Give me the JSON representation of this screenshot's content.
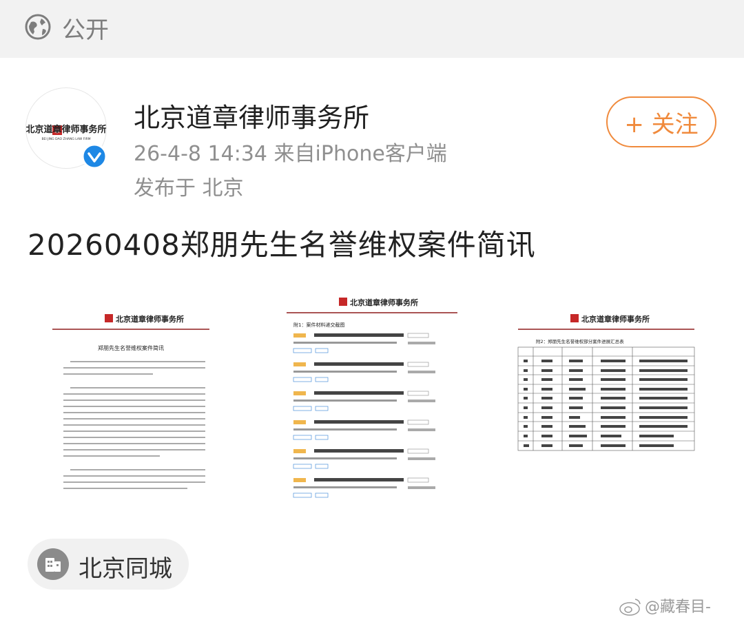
{
  "visibility": {
    "label": "公开",
    "icon": "globe-icon"
  },
  "post": {
    "poster_name": "北京道章律师事务所",
    "meta": "26-4-8 14:34 来自iPhone客户端",
    "location": "发布于 北京",
    "follow_label": "+ 关注",
    "text": "20260408郑朋先生名誉维权案件简讯"
  },
  "avatar": {
    "logo_text": "北京道章律师事务所",
    "logo_sub": "BEI JING DAO ZHANG LAW FIRM",
    "seal": "章道"
  },
  "thumbs": [
    {
      "logo_text": "北京道章律师事务所",
      "title": "郑朋先生名誉维权案件简讯"
    },
    {
      "logo_text": "北京道章律师事务所",
      "title": "附1：案件材料递交截图"
    },
    {
      "logo_text": "北京道章律师事务所",
      "title": "附2：郑朋先生名誉维权部分案件进展汇总表"
    }
  ],
  "geo_tag": {
    "label": "北京同城",
    "icon": "building-icon"
  },
  "watermark": {
    "text": "@藏春目-",
    "icon": "weibo-icon"
  },
  "colors": {
    "accent": "#f08a3c",
    "verified": "#1e88e5",
    "seal": "#c62828"
  }
}
